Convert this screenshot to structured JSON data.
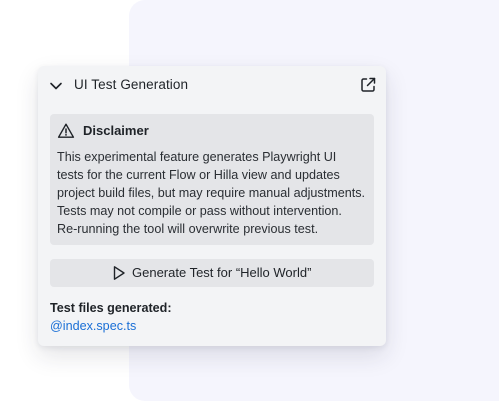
{
  "panel": {
    "title": "UI Test Generation",
    "collapse_icon": "chevron-down-icon",
    "popout_icon": "external-link-icon"
  },
  "disclaimer": {
    "icon": "warning-icon",
    "title": "Disclaimer",
    "lines": [
      "This experimental feature generates Playwright UI",
      "tests for the current Flow or Hilla view and updates",
      "project build files, but may require manual adjustments.",
      "Tests may not compile or pass without intervention.",
      "Re-running the tool will overwrite previous test."
    ]
  },
  "generate_button": {
    "icon": "play-icon",
    "label": "Generate Test for “Hello World”"
  },
  "results": {
    "label": "Test files generated:",
    "files": [
      "@index.spec.ts"
    ]
  },
  "colors": {
    "background_panel": "#f5f5fd",
    "card": "#f3f4f6",
    "disclaimer_box": "#e4e5e8",
    "link": "#1a6fd6",
    "text": "#1f2328"
  }
}
